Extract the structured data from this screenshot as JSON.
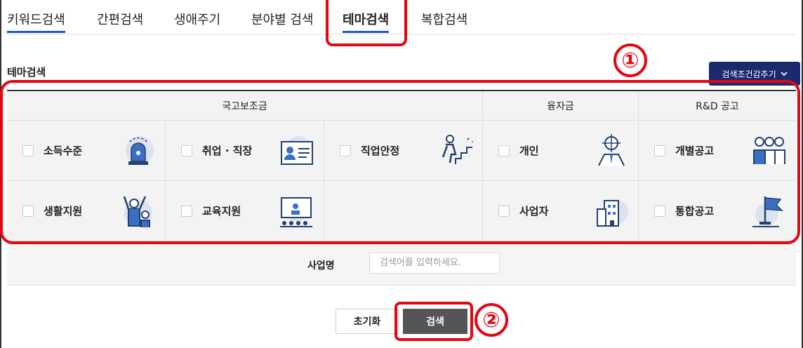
{
  "tabs": [
    {
      "label": "키워드검색"
    },
    {
      "label": "간편검색"
    },
    {
      "label": "생애주기"
    },
    {
      "label": "분야별 검색"
    },
    {
      "label": "테마검색"
    },
    {
      "label": "복합검색"
    }
  ],
  "section_title": "테마검색",
  "add_condition_label": "검색조건감추기",
  "groups": [
    {
      "label": "국고보조금"
    },
    {
      "label": "융자금"
    },
    {
      "label": "R&D 공고"
    }
  ],
  "themes": [
    {
      "label": "소득수준",
      "icon": "siren-icon"
    },
    {
      "label": "취업 · 직장",
      "icon": "id-card-icon"
    },
    {
      "label": "직업안정",
      "icon": "stairs-climb-icon"
    },
    {
      "label": "개인",
      "icon": "target-person-icon"
    },
    {
      "label": "개별공고",
      "icon": "people-group-icon"
    },
    {
      "label": "생활지원",
      "icon": "family-cheer-icon"
    },
    {
      "label": "교육지원",
      "icon": "presentation-icon"
    },
    {
      "label": "사업자",
      "icon": "building-icon"
    },
    {
      "label": "통합공고",
      "icon": "flag-icon"
    }
  ],
  "search": {
    "label": "사업명",
    "placeholder": "검색어를 입력하세요."
  },
  "buttons": {
    "reset": "초기화",
    "search": "검색"
  },
  "annotations": [
    "①",
    "②"
  ],
  "colors": {
    "accent": "#1a5bb8",
    "navy": "#1a2a6c",
    "annotation": "#e30613",
    "search_button": "#555555"
  }
}
